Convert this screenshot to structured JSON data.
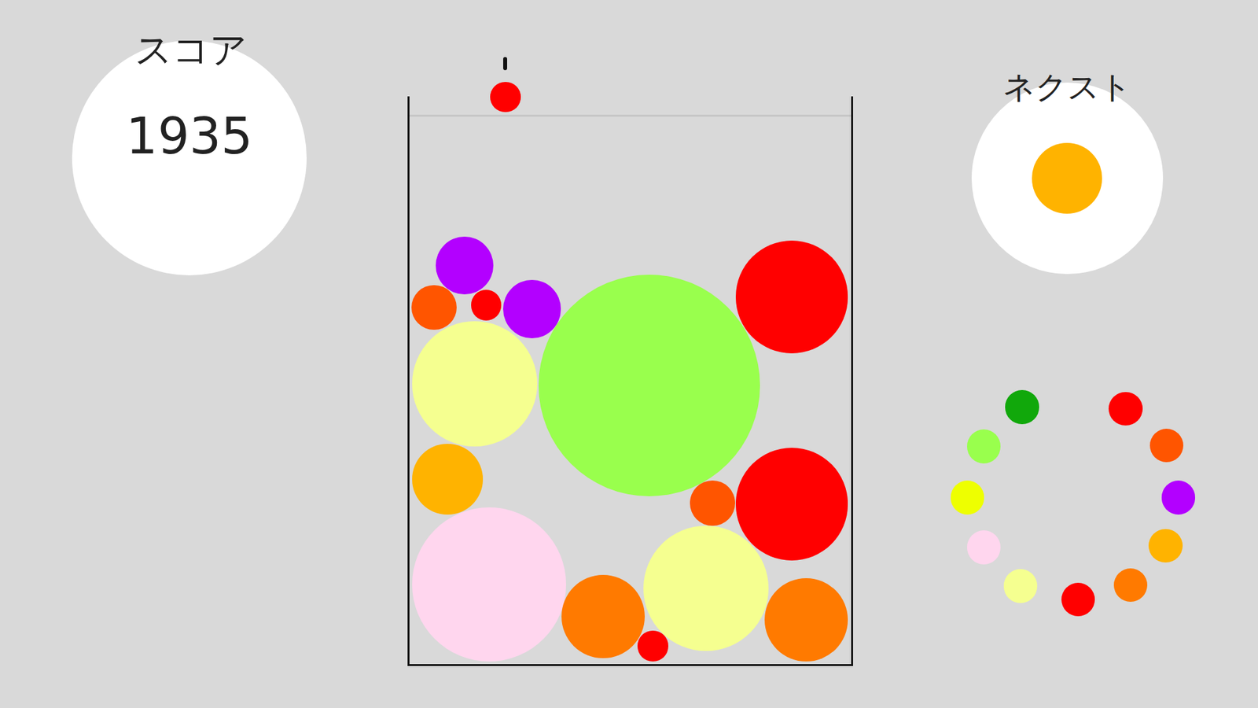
{
  "score": {
    "label": "スコア",
    "value": "1935"
  },
  "next": {
    "label": "ネクスト",
    "color": "#ffb300"
  },
  "dropper": {
    "color": "#ff0000"
  },
  "balls": [
    {
      "color": "#b300ff"
    },
    {
      "color": "#ff5500"
    },
    {
      "color": "#ff0000"
    },
    {
      "color": "#b300ff"
    },
    {
      "color": "#f5ff90"
    },
    {
      "color": "#99ff4d"
    },
    {
      "color": "#ff0000"
    },
    {
      "color": "#ffb300"
    },
    {
      "color": "#ff5500"
    },
    {
      "color": "#ff0000"
    },
    {
      "color": "#ffd6ee"
    },
    {
      "color": "#ff7a00"
    },
    {
      "color": "#f5ff90"
    },
    {
      "color": "#ff7a00"
    },
    {
      "color": "#ff0000"
    }
  ],
  "ring": [
    {
      "color": "#11a80b"
    },
    {
      "color": "#ff0000"
    },
    {
      "color": "#ff5500"
    },
    {
      "color": "#b300ff"
    },
    {
      "color": "#ffb300"
    },
    {
      "color": "#ff7a00"
    },
    {
      "color": "#ff0000"
    },
    {
      "color": "#f5ff90"
    },
    {
      "color": "#ffd6ee"
    },
    {
      "color": "#eeff00"
    },
    {
      "color": "#99ff4d"
    }
  ]
}
